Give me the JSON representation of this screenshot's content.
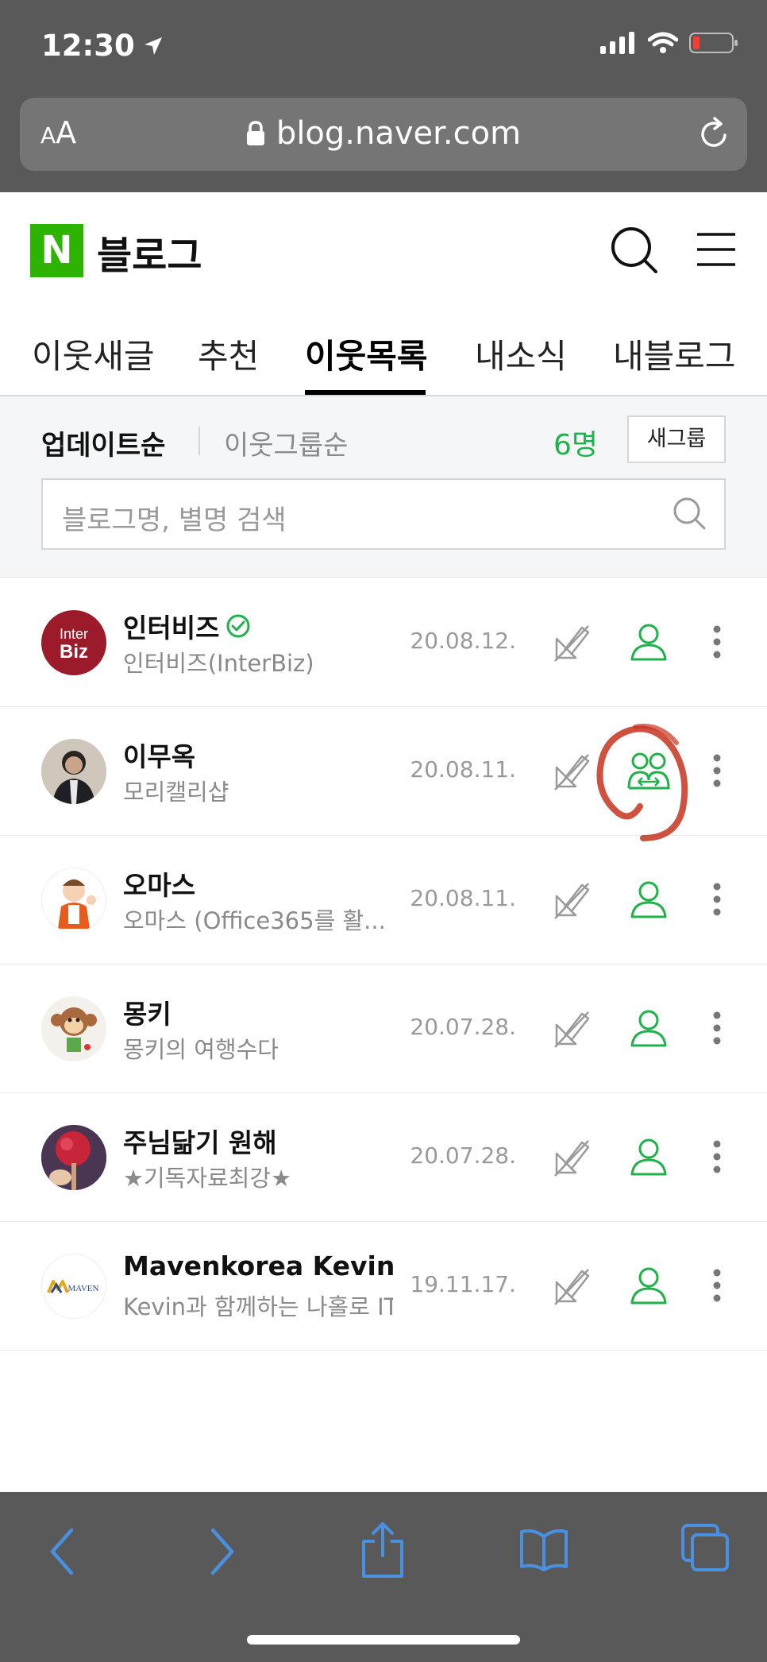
{
  "status_bar": {
    "time": "12:30"
  },
  "browser": {
    "text_size": "AA",
    "url": "blog.naver.com"
  },
  "header": {
    "logo": "N",
    "title": "블로그"
  },
  "tabs": [
    {
      "label": "이웃새글",
      "active": false
    },
    {
      "label": "추천",
      "active": false
    },
    {
      "label": "이웃목록",
      "active": true
    },
    {
      "label": "내소식",
      "active": false
    },
    {
      "label": "내블로그",
      "active": false
    }
  ],
  "sort": {
    "update_order": "업데이트순",
    "group_order": "이웃그룹순",
    "count": "6명",
    "new_group": "새그룹"
  },
  "search": {
    "placeholder": "블로그명, 별명 검색"
  },
  "neighbors": [
    {
      "name": "인터비즈",
      "blog": "인터비즈(InterBiz)",
      "date": "20.08.12.",
      "verified": true,
      "mutual": false
    },
    {
      "name": "이무옥",
      "blog": "모리캘리샵",
      "date": "20.08.11.",
      "verified": false,
      "mutual": true
    },
    {
      "name": "오마스",
      "blog": "오마스 (Office365를 활...",
      "date": "20.08.11.",
      "verified": false,
      "mutual": false
    },
    {
      "name": "몽키",
      "blog": "몽키의 여행수다",
      "date": "20.07.28.",
      "verified": false,
      "mutual": false
    },
    {
      "name": "주님닮기 원해",
      "blog": "★기독자료최강★",
      "date": "20.07.28.",
      "verified": false,
      "mutual": false
    },
    {
      "name": "Mavenkorea Kevin",
      "blog": "Kevin과 함께하는 나홀로 IT",
      "date": "19.11.17.",
      "verified": false,
      "mutual": false
    }
  ],
  "avatars": {
    "interbiz_line1": "Inter",
    "interbiz_line2": "Biz",
    "maven": "MAVEN"
  },
  "colors": {
    "naver_green": "#2db400",
    "count_green": "#20b24a",
    "ios_blue": "#4a90e2"
  }
}
